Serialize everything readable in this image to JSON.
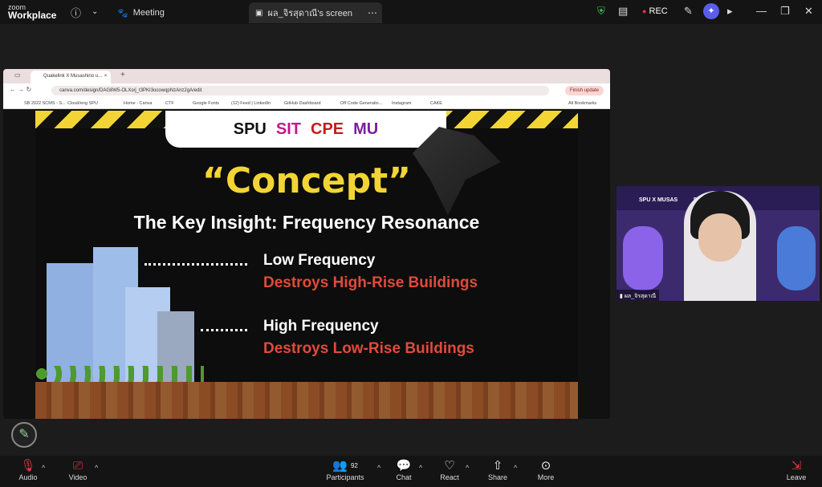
{
  "app": {
    "logo_top": "zoom",
    "logo_bottom": "Workplace"
  },
  "tabs": {
    "meeting": "Meeting",
    "screen": "ผล_จิรสุดาณี's screen"
  },
  "header": {
    "rec_label": "REC"
  },
  "browser": {
    "tab_title": "Quakelink X Musashino u… ×",
    "url": "canva.com/design/DAG8W5-OLXo/j_t3PKI3ocowqpNzAnz2gA/edit",
    "finish_update": "Finish update",
    "bookmarks": [
      "SB 2022 SCMS - S...",
      "Cloud/eng SPU",
      "Home - Canva",
      "CTF",
      "Google Fonts",
      "(12) Feed | LinkedIn",
      "GitHub Dashboard",
      "Off Code Generatio...",
      "Instagram",
      "CAKE",
      "All Bookmarks"
    ]
  },
  "slide": {
    "logos": {
      "spu": "SPU",
      "sit": "SIT",
      "cpe": "CPE",
      "mu": "MU"
    },
    "title": "“Concept”",
    "subtitle": "The Key Insight: Frequency Resonance",
    "low_heading": "Low Frequency",
    "low_desc": "Destroys High-Rise Buildings",
    "high_heading": "High Frequency",
    "high_desc": "Destroys Low-Rise Buildings"
  },
  "video": {
    "banner": "SPU X MUSAS          SE TALK 2026",
    "participant_name": "ผล_จิรสุดาณี"
  },
  "toolbar": {
    "audio": "Audio",
    "video": "Video",
    "participants": "Participants",
    "participant_count": "92",
    "chat": "Chat",
    "react": "React",
    "share": "Share",
    "more": "More",
    "leave": "Leave"
  },
  "colors": {
    "accent_yellow": "#f2d535",
    "accent_red": "#e04a3c",
    "video_bg": "#3c2a6e"
  }
}
